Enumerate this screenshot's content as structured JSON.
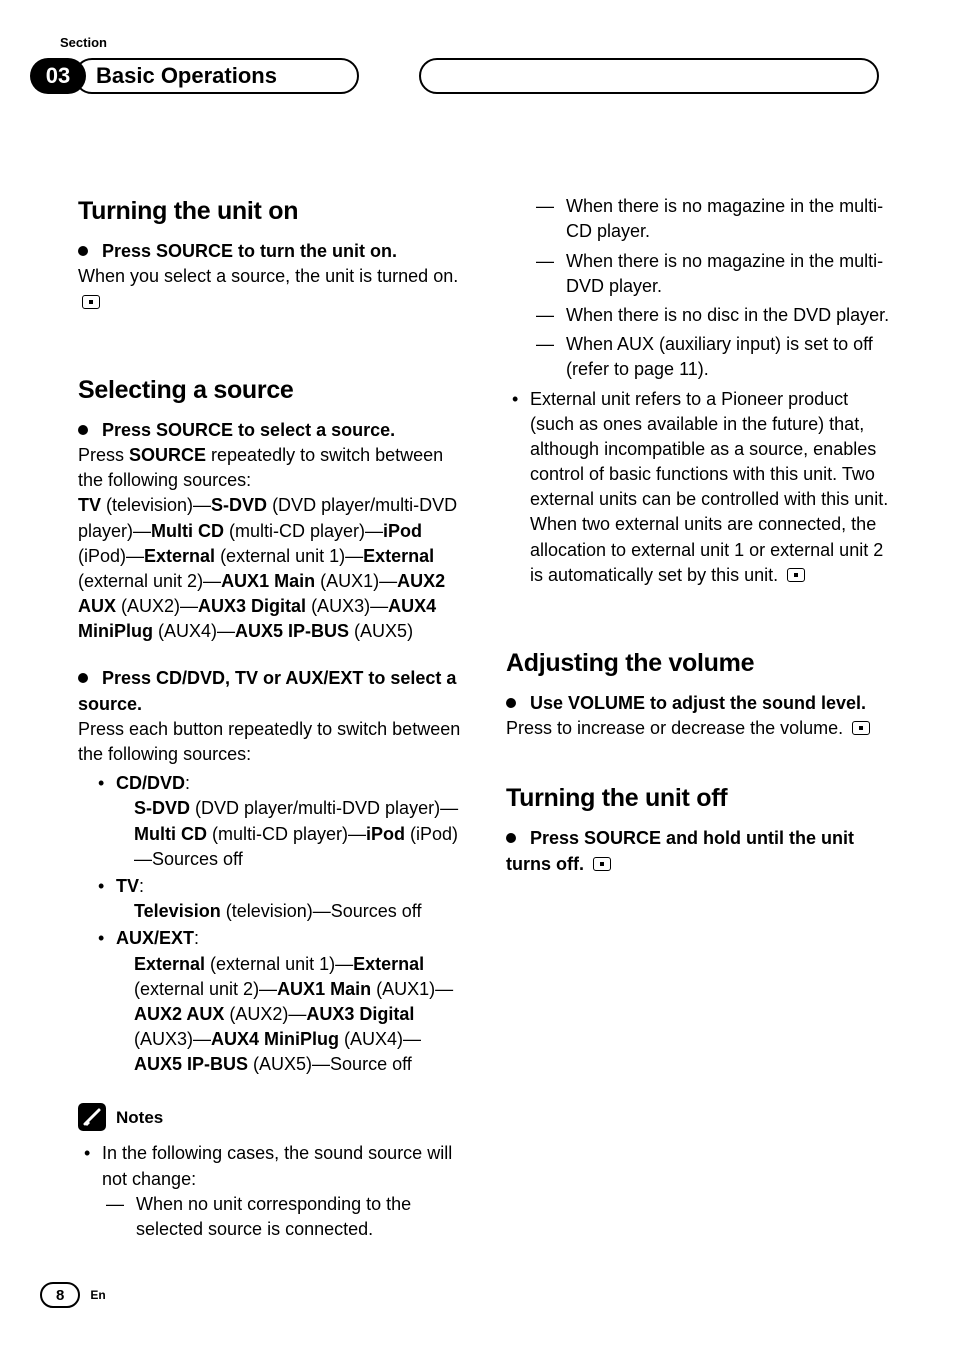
{
  "header": {
    "section_label": "Section",
    "chapter_number": "03",
    "chapter_title": "Basic Operations"
  },
  "left": {
    "turn_on": {
      "title": "Turning the unit on",
      "instr": "Press SOURCE to turn the unit on.",
      "body": "When you select a source, the unit is turned on."
    },
    "select_src": {
      "title": "Selecting a source",
      "instr1": "Press SOURCE to select a source.",
      "body1a": "Press ",
      "body1b": "SOURCE",
      "body1c": " repeatedly to switch between the following sources:",
      "chain": {
        "tv": "TV",
        "tv_d": " (television)—",
        "sdvd": "S-DVD",
        "sdvd_d": " (DVD player/multi-DVD player)—",
        "mcd": "Multi CD",
        "mcd_d": " (multi-CD player)—",
        "ipod": "iPod",
        "ipod_d": " (iPod)—",
        "ext1": "External",
        "ext1_d": " (external unit 1)—",
        "ext2": "External",
        "ext2_d": " (external unit 2)—",
        "aux1": "AUX1 Main",
        "aux1_d": " (AUX1)—",
        "aux2": "AUX2 AUX",
        "aux2_d": " (AUX2)—",
        "aux3": "AUX3 Digital",
        "aux3_d": " (AUX3)—",
        "aux4": "AUX4 MiniPlug",
        "aux4_d": " (AUX4)—",
        "aux5": "AUX5 IP-BUS",
        "aux5_d": " (AUX5)"
      },
      "instr2": "Press CD/DVD, TV or AUX/EXT to select a source.",
      "body2": "Press each button repeatedly to switch between the following sources:",
      "items": {
        "cddvd_h": "CD/DVD",
        "colon": ":",
        "cddvd_b_sdvd": "S-DVD",
        "cddvd_b_sdvd_d": " (DVD player/multi-DVD player)—",
        "cddvd_b_mcd": "Multi CD",
        "cddvd_b_mcd_d": " (multi-CD player)—",
        "cddvd_b_ipod": "iPod",
        "cddvd_b_ipod_d": " (iPod)—Sources off",
        "tv_h": "TV",
        "tv_b_tv": "Television",
        "tv_b_tv_d": " (television)—Sources off",
        "aux_h": "AUX/EXT",
        "aux_b_e1": "External",
        "aux_b_e1_d": " (external unit 1)—",
        "aux_b_e2": "External",
        "aux_b_e2_d": " (external unit 2)—",
        "aux_b_a1": "AUX1 Main",
        "aux_b_a1_d": " (AUX1)—",
        "aux_b_a2": "AUX2 AUX",
        "aux_b_a2_d": " (AUX2)—",
        "aux_b_a3": "AUX3 Digital",
        "aux_b_a3_d": " (AUX3)—",
        "aux_b_a4": "AUX4 MiniPlug",
        "aux_b_a4_d": " (AUX4)—",
        "aux_b_a5": "AUX5 IP-BUS",
        "aux_b_a5_d": " (AUX5)—Source off"
      }
    },
    "notes": {
      "label": "Notes",
      "n1": "In the following cases, the sound source will not change:",
      "n1a": "When no unit corresponding to the selected source is connected."
    }
  },
  "right": {
    "cont": {
      "d1": "When there is no magazine in the multi-CD player.",
      "d2": "When there is no magazine in the multi-DVD player.",
      "d3": "When there is no disc in the DVD player.",
      "d4": "When AUX (auxiliary input) is set to off (refer to page 11).",
      "n2": "External unit refers to a Pioneer product (such as ones available in the future) that, although incompatible as a source, enables control of basic functions with this unit. Two external units can be controlled with this unit. When two external units are connected, the allocation to external unit 1 or external unit 2 is automatically set by this unit."
    },
    "volume": {
      "title": "Adjusting the volume",
      "instr": "Use VOLUME to adjust the sound level.",
      "body": "Press to increase or decrease the volume."
    },
    "turn_off": {
      "title": "Turning the unit off",
      "instr": "Press SOURCE and hold until the unit turns off."
    }
  },
  "footer": {
    "page": "8",
    "lang": "En"
  }
}
